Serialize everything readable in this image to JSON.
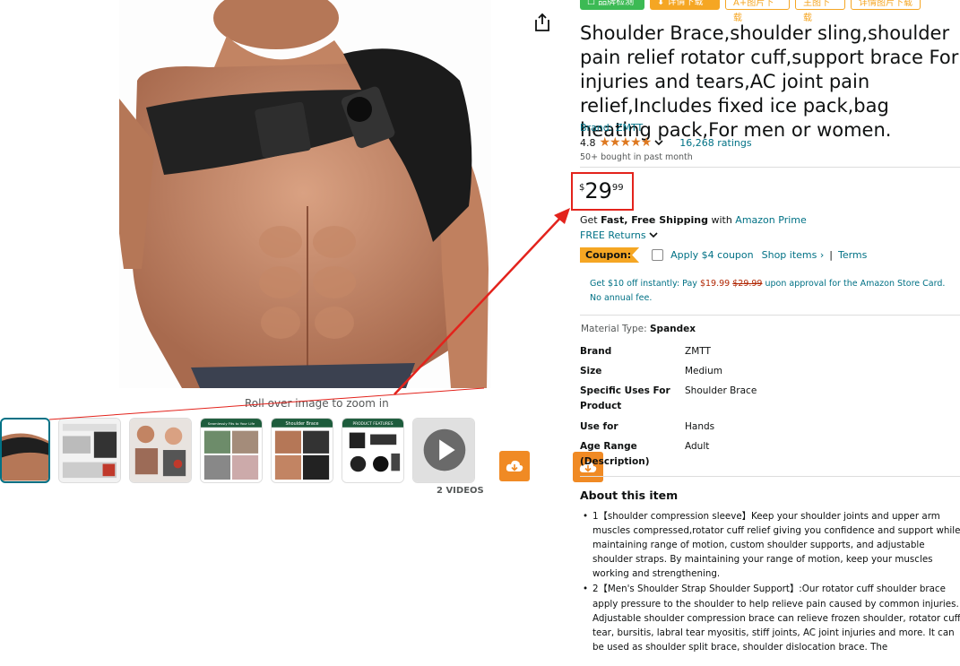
{
  "toolbar_badges": [
    "☐ 品牌检测",
    "⬇ 详情下载",
    "A+图片下载",
    "主图下载",
    "详情图片下载"
  ],
  "product": {
    "title": "Shoulder Brace,shoulder sling,shoulder pain relief rotator cuff,support brace For injuries and tears,AC joint pain relief,Includes fixed ice pack,bag heating pack,For men or women.",
    "brand_link": "Brand: ZMTT",
    "rating": "4.8",
    "stars": "★★★★★",
    "ratings_count": "16,268 ratings",
    "bought": "50+ bought in past month",
    "price": {
      "symbol": "$",
      "whole": "29",
      "fraction": "99"
    },
    "shipping": {
      "prefix": "Get ",
      "bold": "Fast, Free Shipping",
      "middle": " with ",
      "link": "Amazon Prime"
    },
    "returns": "FREE Returns",
    "coupon": {
      "tag": "Coupon:",
      "apply_text": "Apply $4 coupon",
      "shop_items": "Shop items ›",
      "separator": "|",
      "terms": "Terms"
    },
    "card_offer": {
      "pre": "Get $10 off instantly: Pay ",
      "new_price": "$19.99",
      "old_price": "$29.99",
      "post": " upon approval for the Amazon Store Card. No annual fee."
    },
    "material": {
      "label": "Material Type: ",
      "value": "Spandex"
    },
    "specs": [
      {
        "key": "Brand",
        "value": "ZMTT"
      },
      {
        "key": "Size",
        "value": "Medium"
      },
      {
        "key": "Specific Uses For Product",
        "value": "Shoulder Brace"
      },
      {
        "key": "Use for",
        "value": "Hands"
      },
      {
        "key": "Age Range (Description)",
        "value": "Adult"
      }
    ],
    "about_title": "About this item",
    "bullets": [
      "1【shoulder compression sleeve】Keep your shoulder joints and upper arm muscles compressed,rotator cuff relief giving you confidence and support while maintaining range of motion, custom shoulder supports, and adjustable shoulder straps. By maintaining your range of motion, keep your muscles working and strengthening.",
      "2【Men's Shoulder Strap Shoulder Support】:Our rotator cuff shoulder brace apply pressure to the shoulder to help relieve pain caused by common injuries. Adjustable shoulder compression brace can relieve frozen shoulder, rotator cuff tear, bursitis, labral tear myositis, stiff joints, AC joint injuries and more. It can be used as shoulder split brace, shoulder dislocation brace. The"
    ]
  },
  "gallery": {
    "zoom_hint": "Roll over image to zoom in",
    "videos_label": "2 VIDEOS",
    "thumb_captions": [
      "Seamlessly Fits to Your Life",
      "Shoulder Brace",
      "PRODUCT FEATURES"
    ]
  },
  "colors": {
    "accent_link": "#007185",
    "price_box": "#e3231c",
    "coupon": "#f5a623",
    "download": "#f08a24"
  }
}
